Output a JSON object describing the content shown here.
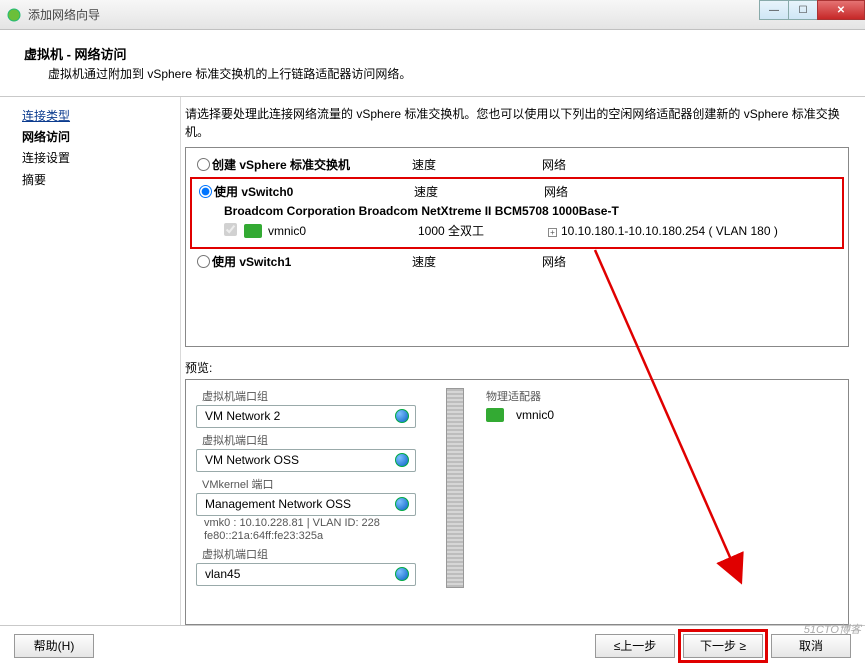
{
  "window": {
    "title": "添加网络向导"
  },
  "header": {
    "title": "虚拟机 - 网络访问",
    "subtitle": "虚拟机通过附加到 vSphere 标准交换机的上行链路适配器访问网络。"
  },
  "sidebar": {
    "items": [
      {
        "label": "连接类型",
        "kind": "link"
      },
      {
        "label": "网络访问",
        "kind": "active"
      },
      {
        "label": "连接设置",
        "kind": "plain"
      },
      {
        "label": "摘要",
        "kind": "plain"
      }
    ]
  },
  "content": {
    "instruction": "请选择要处理此连接网络流量的 vSphere 标准交换机。您也可以使用以下列出的空闲网络适配器创建新的 vSphere 标准交换机。",
    "columns": {
      "speed": "速度",
      "network": "网络"
    },
    "options": [
      {
        "label": "创建 vSphere 标准交换机",
        "selected": false
      },
      {
        "label": "使用 vSwitch0",
        "selected": true,
        "adapter": "Broadcom Corporation Broadcom NetXtreme II BCM5708 1000Base-T",
        "nic": {
          "name": "vmnic0",
          "speed": "1000 全双工",
          "net": "10.10.180.1-10.10.180.254 ( VLAN 180 )"
        }
      },
      {
        "label": "使用 vSwitch1",
        "selected": false
      }
    ]
  },
  "preview": {
    "label": "预览:",
    "left_heading": "虚拟机端口组",
    "mgmt_heading": "VMkernel 端口",
    "right_heading": "物理适配器",
    "groups": [
      {
        "title": "虚拟机端口组",
        "name": "VM Network 2"
      },
      {
        "title": "虚拟机端口组",
        "name": "VM Network OSS"
      }
    ],
    "mgmt": {
      "name": "Management Network OSS",
      "line1": "vmk0 : 10.10.228.81 | VLAN ID: 228",
      "line2": "fe80::21a:64ff:fe23:325a"
    },
    "vlan_group": {
      "title": "虚拟机端口组",
      "name": "vlan45"
    },
    "phys": {
      "name": "vmnic0"
    }
  },
  "footer": {
    "help": "帮助(H)",
    "back": "≤上一步",
    "next": "下一步 ≥",
    "cancel": "取消"
  },
  "watermark": "51CTO博客"
}
